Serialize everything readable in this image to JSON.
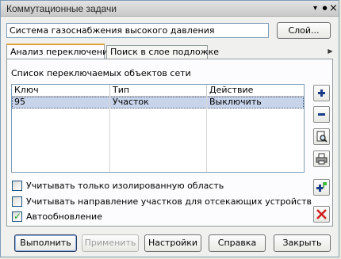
{
  "window": {
    "title": "Коммутационные задачи",
    "controls": {
      "minimize": "▾",
      "pin": "●",
      "close": "×"
    }
  },
  "layer": {
    "value": "Система газоснабжения высокого давления",
    "button": "Слой..."
  },
  "tabs": [
    {
      "label": "Анализ переключений",
      "active": true
    },
    {
      "label": "Поиск в слое подложке",
      "active": false
    }
  ],
  "tab_scroll_icon": "arrow-right-icon",
  "list": {
    "caption": "Список переключаемых объектов сети",
    "columns": [
      "Ключ",
      "Тип",
      "Действие"
    ],
    "rows": [
      {
        "key": "95",
        "type": "Участок",
        "action": "Выключить",
        "selected": true
      }
    ]
  },
  "side_buttons": [
    {
      "name": "add-button",
      "icon": "plus-icon"
    },
    {
      "name": "remove-button",
      "icon": "minus-icon"
    },
    {
      "name": "preview-button",
      "icon": "magnifier-page-icon"
    },
    {
      "name": "print-button",
      "icon": "printer-icon"
    },
    {
      "name": "add-from-map-button",
      "icon": "plus-flag-icon"
    },
    {
      "name": "delete-all-button",
      "icon": "red-cross-icon"
    }
  ],
  "options": [
    {
      "label": "Учитывать только изолированную область",
      "checked": false
    },
    {
      "label": "Учитывать направление участков для отсекающих устройств",
      "checked": false
    },
    {
      "label": "Автообновление",
      "checked": true
    }
  ],
  "buttons": {
    "run": "Выполнить",
    "apply": "Применить",
    "settings": "Настройки",
    "help": "Справка",
    "close": "Закрыть"
  },
  "colors": {
    "selection": "#c7d4ea",
    "tab_accent": "#e0a23c",
    "border": "#7f9db9"
  }
}
